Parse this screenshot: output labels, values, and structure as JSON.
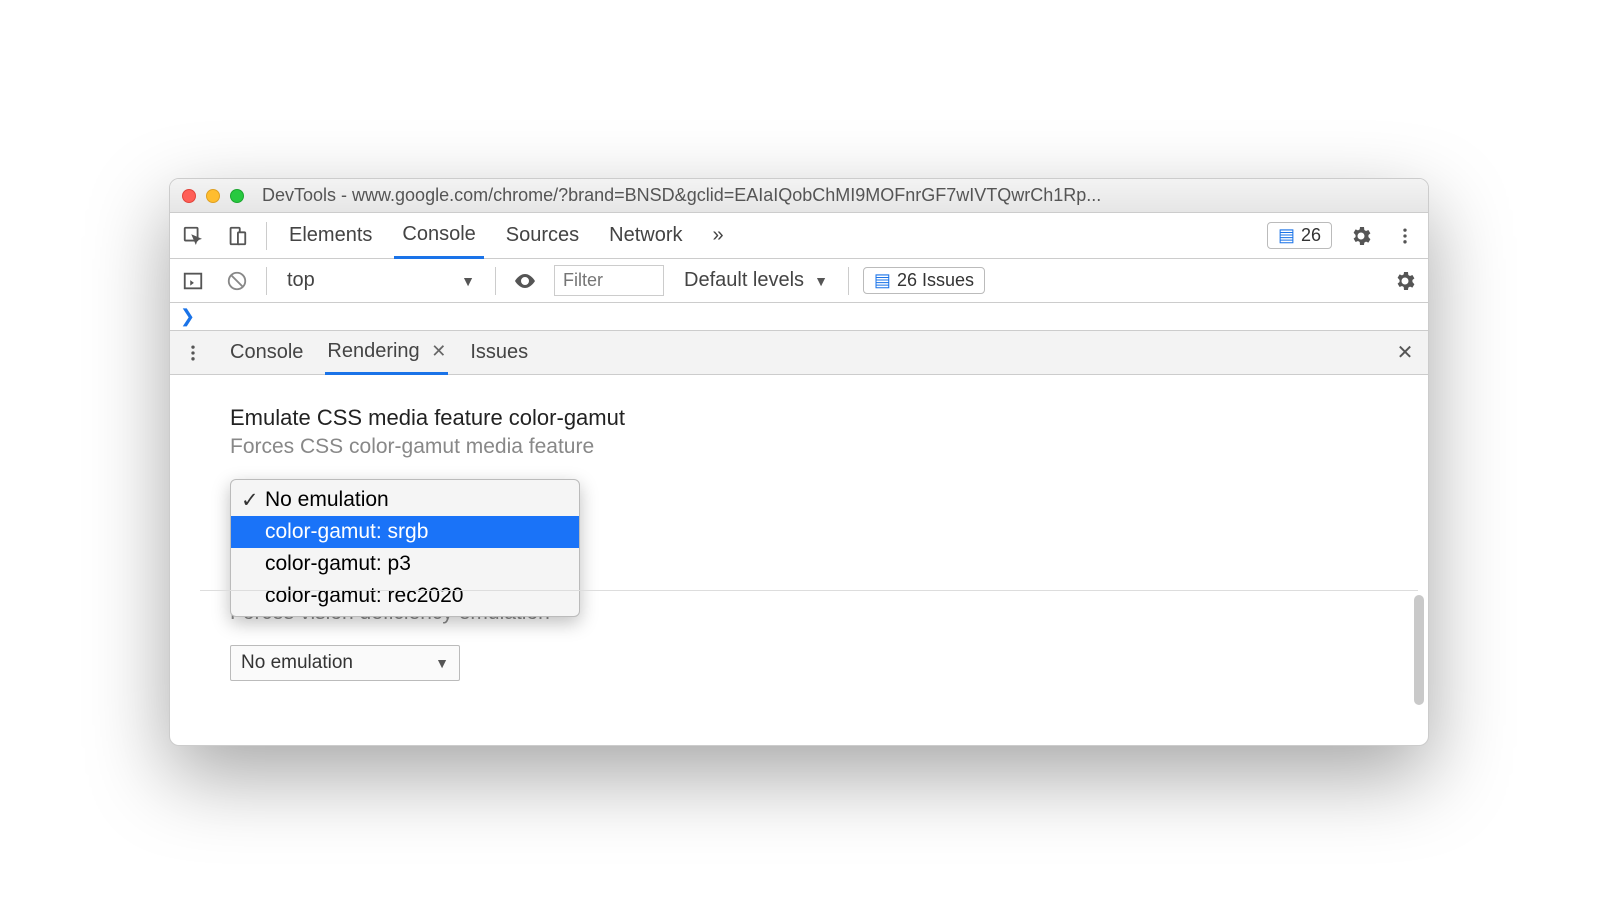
{
  "window": {
    "title": "DevTools - www.google.com/chrome/?brand=BNSD&gclid=EAIaIQobChMI9MOFnrGF7wIVTQwrCh1Rp..."
  },
  "main_tabs": {
    "elements": "Elements",
    "console": "Console",
    "sources": "Sources",
    "network": "Network",
    "more": "»",
    "issues_count": "26"
  },
  "console_toolbar": {
    "context": "top",
    "filter_placeholder": "Filter",
    "levels": "Default levels",
    "issues_label": "26 Issues"
  },
  "prompt": "❯",
  "drawer_tabs": {
    "console": "Console",
    "rendering": "Rendering",
    "issues": "Issues"
  },
  "rendering": {
    "heading": "Emulate CSS media feature color-gamut",
    "subheading": "Forces CSS color-gamut media feature",
    "menu": {
      "no_emulation": "No emulation",
      "srgb": "color-gamut: srgb",
      "p3": "color-gamut: p3",
      "rec2020": "color-gamut: rec2020"
    },
    "below_sub": "Forces vision deficiency emulation",
    "vision_select": "No emulation"
  }
}
